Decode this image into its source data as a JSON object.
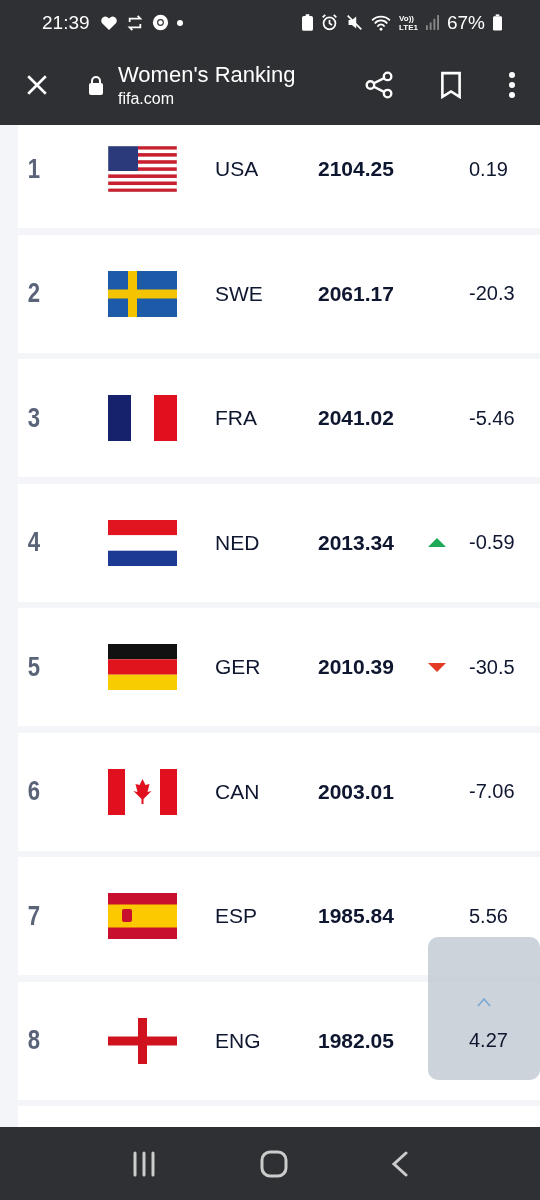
{
  "status_bar": {
    "time": "21:39",
    "volte": [
      "Vo))",
      "LTE1"
    ],
    "battery": "67%"
  },
  "app_bar": {
    "title": "Women's Ranking",
    "url": "fifa.com"
  },
  "rankings": [
    {
      "rank": "1",
      "flag": {
        "kind": "usa"
      },
      "code": "USA",
      "points": "2104.25",
      "change": "0.19"
    },
    {
      "rank": "2",
      "flag": {
        "kind": "sweden"
      },
      "code": "SWE",
      "points": "2061.17",
      "change": "-20.3"
    },
    {
      "rank": "3",
      "flag": {
        "kind": "france"
      },
      "code": "FRA",
      "points": "2041.02",
      "change": "-5.46"
    },
    {
      "rank": "4",
      "flag": {
        "kind": "netherlands"
      },
      "code": "NED",
      "points": "2013.34",
      "trend": {
        "kind": "up"
      },
      "change": "-0.59"
    },
    {
      "rank": "5",
      "flag": {
        "kind": "germany"
      },
      "code": "GER",
      "points": "2010.39",
      "trend": {
        "kind": "down"
      },
      "change": "-30.5"
    },
    {
      "rank": "6",
      "flag": {
        "kind": "canada"
      },
      "code": "CAN",
      "points": "2003.01",
      "change": "-7.06"
    },
    {
      "rank": "7",
      "flag": {
        "kind": "spain"
      },
      "code": "ESP",
      "points": "1985.84",
      "change": "5.56"
    },
    {
      "rank": "8",
      "flag": {
        "kind": "england"
      },
      "code": "ENG",
      "points": "1982.05",
      "change": "4.27"
    }
  ]
}
